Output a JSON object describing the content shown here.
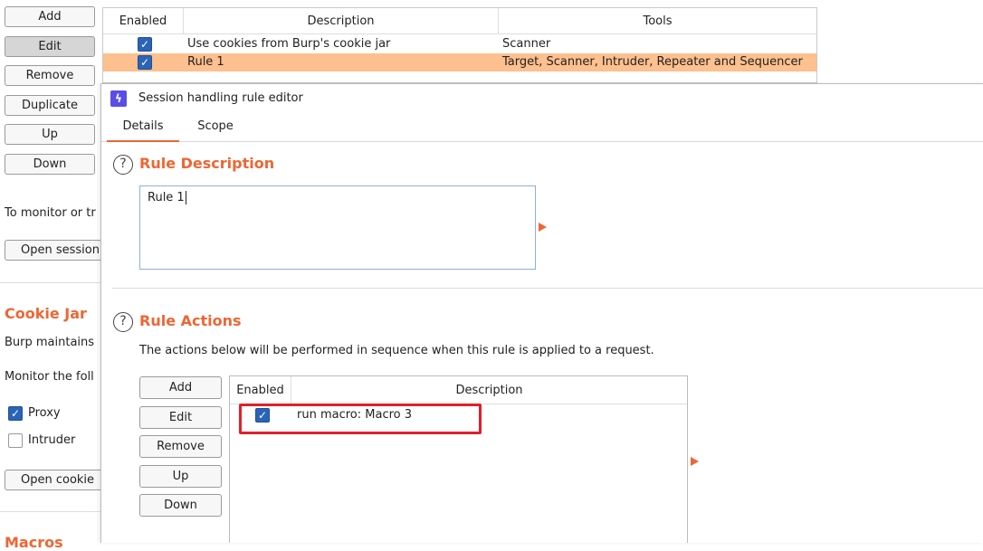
{
  "background": {
    "buttons": [
      "Add",
      "Edit",
      "Remove",
      "Duplicate",
      "Up",
      "Down"
    ],
    "monitor_text": "To monitor or tr",
    "open_session_label": "Open session",
    "cookie_jar_heading": "Cookie Jar",
    "burp_maintains_text": "Burp maintains",
    "monitor_following_text": "Monitor the foll",
    "proxy_label": "Proxy",
    "intruder_label": "Intruder",
    "open_cookie_label": "Open cookie",
    "macros_heading": "Macros"
  },
  "rules_table": {
    "headers": [
      "Enabled",
      "Description",
      "Tools"
    ],
    "rows": [
      {
        "enabled": true,
        "description": "Use cookies from Burp's cookie jar",
        "tools": "Scanner"
      },
      {
        "enabled": true,
        "description": "Rule 1",
        "tools": "Target, Scanner, Intruder, Repeater and Sequencer"
      }
    ]
  },
  "dialog": {
    "title": "Session handling rule editor",
    "tabs": [
      "Details",
      "Scope"
    ],
    "rule_description_heading": "Rule Description",
    "rule_description_value": "Rule 1",
    "rule_actions_heading": "Rule Actions",
    "rule_actions_text": "The actions below will be performed in sequence when this rule is applied to a request.",
    "action_buttons": [
      "Add",
      "Edit",
      "Remove",
      "Up",
      "Down"
    ],
    "actions_table": {
      "headers": [
        "Enabled",
        "Description"
      ],
      "rows": [
        {
          "enabled": true,
          "description": "run macro: Macro 3"
        }
      ]
    }
  },
  "colors": {
    "accent": "#ee6633",
    "selected_row": "#fdc08e",
    "checkbox": "#2a64b8",
    "highlight_box": "#e0202a"
  }
}
